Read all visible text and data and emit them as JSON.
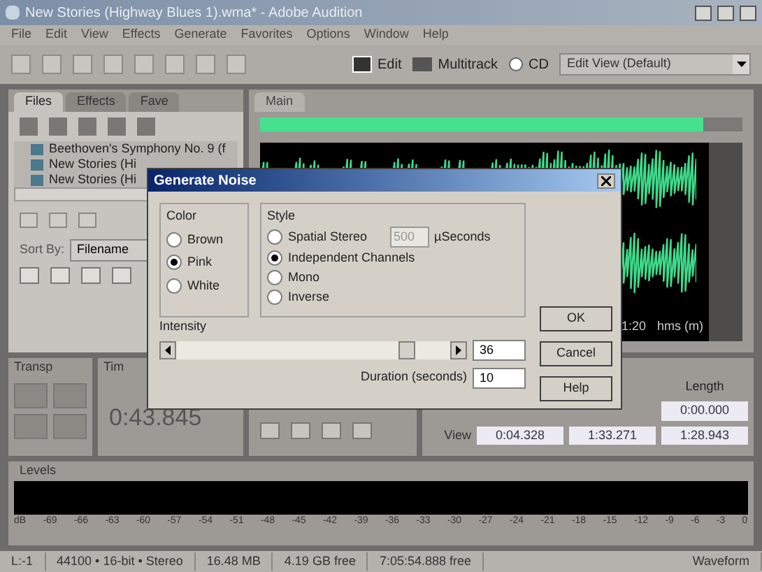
{
  "window": {
    "title": "New Stories (Highway Blues 1).wma* - Adobe Audition"
  },
  "menu": [
    "File",
    "Edit",
    "View",
    "Effects",
    "Generate",
    "Favorites",
    "Options",
    "Window",
    "Help"
  ],
  "toolbar": {
    "edit": "Edit",
    "multitrack": "Multitrack",
    "cd": "CD",
    "workspace": "Edit View (Default)"
  },
  "files_panel": {
    "tabs": [
      {
        "label": "Files",
        "selected": true
      },
      {
        "label": "Effects",
        "selected": false
      },
      {
        "label": "Fave",
        "selected": false
      }
    ],
    "files": [
      "Beethoven's Symphony No. 9 (f",
      "New Stories (Hi",
      "New Stories (Hi"
    ],
    "sort_label": "Sort By:",
    "sort_value": "Filename"
  },
  "main": {
    "tab": "Main",
    "time_label": "1:20",
    "time_units": "hms (m)"
  },
  "transport": {
    "tab": "Transp"
  },
  "time": {
    "tab": "Tim",
    "value": "0:43.845"
  },
  "selection": {
    "length_header": "Length",
    "length_value": "0:00.000",
    "view_label": "View",
    "view_values": [
      "0:04.328",
      "1:33.271",
      "1:28.943"
    ]
  },
  "levels": {
    "tab": "Levels",
    "scale": [
      "dB",
      "-69",
      "-66",
      "-63",
      "-60",
      "-57",
      "-54",
      "-51",
      "-48",
      "-45",
      "-42",
      "-39",
      "-36",
      "-33",
      "-30",
      "-27",
      "-24",
      "-21",
      "-18",
      "-15",
      "-12",
      "-9",
      "-6",
      "-3",
      "0"
    ]
  },
  "status_bar": [
    "L:-1",
    "44100 • 16-bit • Stereo",
    "16.48 MB",
    "4.19 GB free",
    "7:05:54.888 free",
    "Waveform"
  ],
  "dialog": {
    "title": "Generate Noise",
    "color_group": "Color",
    "colors": [
      {
        "label": "Brown",
        "selected": false
      },
      {
        "label": "Pink",
        "selected": true
      },
      {
        "label": "White",
        "selected": false
      }
    ],
    "style_group": "Style",
    "styles": [
      {
        "label": "Spatial Stereo",
        "selected": false
      },
      {
        "label": "Independent Channels",
        "selected": true
      },
      {
        "label": "Mono",
        "selected": false
      },
      {
        "label": "Inverse",
        "selected": false
      }
    ],
    "spatial_value": "500",
    "spatial_units": "µSeconds",
    "intensity_label": "Intensity",
    "intensity": {
      "level": 0.87
    },
    "intensity_value": "36",
    "duration_label": "Duration (seconds)",
    "duration_value": "10",
    "buttons": [
      "OK",
      "Cancel",
      "Help"
    ]
  }
}
